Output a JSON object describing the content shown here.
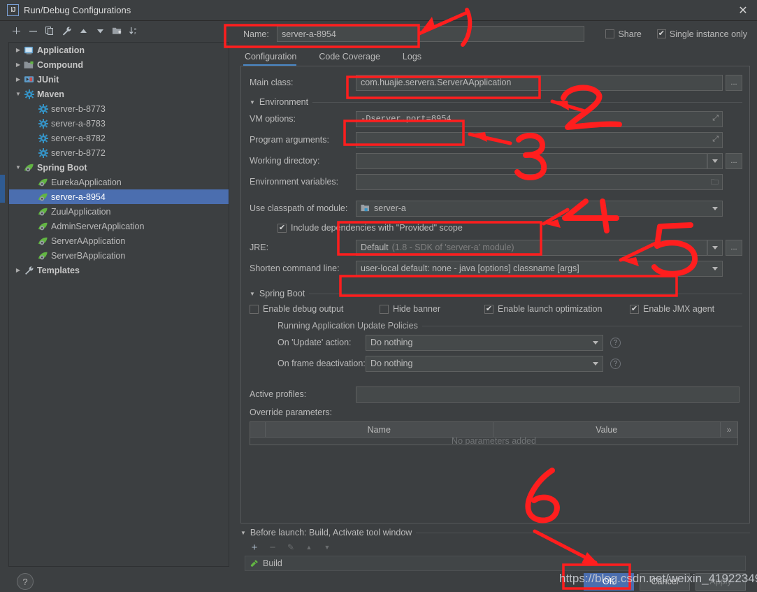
{
  "window": {
    "title": "Run/Debug Configurations",
    "app_icon": "IJ",
    "close_icon": "close-icon"
  },
  "toolbar": {
    "buttons": [
      {
        "name": "add-configuration",
        "icon": "plus-icon",
        "label": "+"
      },
      {
        "name": "remove-configuration",
        "icon": "minus-icon",
        "label": "−"
      },
      {
        "name": "copy-configuration",
        "icon": "copy-icon",
        "label": "copy"
      },
      {
        "name": "edit-templates",
        "icon": "wrench-icon",
        "label": "wrench"
      },
      {
        "name": "move-up",
        "icon": "arrow-up-icon",
        "label": "up"
      },
      {
        "name": "move-down",
        "icon": "arrow-down-icon",
        "label": "down"
      },
      {
        "name": "new-folder",
        "icon": "folder-add-icon",
        "label": "folder"
      },
      {
        "name": "sort-alphabetically",
        "icon": "sort-az-icon",
        "label": "sort"
      }
    ]
  },
  "tree": {
    "nodes": [
      {
        "label": "Application",
        "icon": "application-icon",
        "group": true,
        "expanded": false,
        "indent": 0,
        "selected": false
      },
      {
        "label": "Compound",
        "icon": "compound-icon",
        "group": true,
        "expanded": false,
        "indent": 0,
        "selected": false
      },
      {
        "label": "JUnit",
        "icon": "junit-icon",
        "group": true,
        "expanded": false,
        "indent": 0,
        "selected": false
      },
      {
        "label": "Maven",
        "icon": "maven-icon",
        "group": true,
        "expanded": true,
        "indent": 0,
        "selected": false
      },
      {
        "label": "server-b-8773",
        "icon": "maven-icon",
        "group": false,
        "indent": 1,
        "selected": false
      },
      {
        "label": "server-a-8783",
        "icon": "maven-icon",
        "group": false,
        "indent": 1,
        "selected": false
      },
      {
        "label": "server-a-8782",
        "icon": "maven-icon",
        "group": false,
        "indent": 1,
        "selected": false
      },
      {
        "label": "server-b-8772",
        "icon": "maven-icon",
        "group": false,
        "indent": 1,
        "selected": false
      },
      {
        "label": "Spring Boot",
        "icon": "spring-boot-icon",
        "group": true,
        "expanded": true,
        "indent": 0,
        "selected": false
      },
      {
        "label": "EurekaApplication",
        "icon": "spring-boot-icon",
        "group": false,
        "indent": 1,
        "selected": false
      },
      {
        "label": "server-a-8954",
        "icon": "spring-boot-icon",
        "group": false,
        "indent": 1,
        "selected": true
      },
      {
        "label": "ZuulApplication",
        "icon": "spring-boot-icon",
        "group": false,
        "indent": 1,
        "selected": false
      },
      {
        "label": "AdminServerApplication",
        "icon": "spring-boot-icon",
        "group": false,
        "indent": 1,
        "selected": false
      },
      {
        "label": "ServerAApplication",
        "icon": "spring-boot-icon",
        "group": false,
        "indent": 1,
        "selected": false
      },
      {
        "label": "ServerBApplication",
        "icon": "spring-boot-icon",
        "group": false,
        "indent": 1,
        "selected": false
      },
      {
        "label": "Templates",
        "icon": "templates-icon",
        "group": true,
        "expanded": false,
        "indent": 0,
        "selected": false
      }
    ]
  },
  "header": {
    "name_label": "Name:",
    "name_value": "server-a-8954",
    "share_label": "Share",
    "share_checked": false,
    "single_instance_label": "Single instance only",
    "single_instance_checked": true
  },
  "tabs": [
    {
      "label": "Configuration",
      "active": true
    },
    {
      "label": "Code Coverage",
      "active": false
    },
    {
      "label": "Logs",
      "active": false
    }
  ],
  "form": {
    "main_class": {
      "label": "Main class:",
      "value": "com.huajie.servera.ServerAApplication",
      "browse": "..."
    },
    "environment_group": "Environment",
    "vm_options": {
      "label": "VM options:",
      "value": "-Dserver.port=8954"
    },
    "program_arguments": {
      "label": "Program arguments:",
      "value": ""
    },
    "working_directory": {
      "label": "Working directory:",
      "value": "",
      "browse": "..."
    },
    "environment_variables": {
      "label": "Environment variables:",
      "value": "",
      "icon": "folder-icon"
    },
    "use_classpath": {
      "label": "Use classpath of module:",
      "value": "server-a",
      "icon": "module-icon"
    },
    "include_provided": {
      "label": "Include dependencies with \"Provided\" scope",
      "checked": true
    },
    "jre": {
      "label": "JRE:",
      "value": "Default",
      "hint": "(1.8 - SDK of 'server-a' module)",
      "browse": "..."
    },
    "shorten_command_line": {
      "label": "Shorten command line:",
      "value": "user-local default: none - java [options] classname [args]"
    }
  },
  "spring_boot": {
    "group_label": "Spring Boot",
    "checkboxes": [
      {
        "label": "Enable debug output",
        "checked": false
      },
      {
        "label": "Hide banner",
        "checked": false
      },
      {
        "label": "Enable launch optimization",
        "checked": true
      },
      {
        "label": "Enable JMX agent",
        "checked": true
      }
    ],
    "update_policies_label": "Running Application Update Policies",
    "on_update_action": {
      "label": "On 'Update' action:",
      "value": "Do nothing",
      "help": "?"
    },
    "on_frame_deactivation": {
      "label": "On frame deactivation:",
      "value": "Do nothing",
      "help": "?"
    },
    "active_profiles": {
      "label": "Active profiles:",
      "value": ""
    },
    "override_parameters": {
      "label": "Override parameters:",
      "columns": [
        "",
        "Name",
        "Value",
        "»"
      ],
      "empty_text": "No parameters added",
      "rows": []
    }
  },
  "before_launch": {
    "title": "Before launch: Build, Activate tool window",
    "toolbar": [
      {
        "name": "add-task",
        "icon": "plus-icon",
        "label": "+",
        "enabled": true
      },
      {
        "name": "remove-task",
        "icon": "minus-icon",
        "label": "−",
        "enabled": false
      },
      {
        "name": "edit-task",
        "icon": "pencil-icon",
        "label": "✎",
        "enabled": false
      },
      {
        "name": "move-task-up",
        "icon": "arrow-up-icon",
        "label": "▲",
        "enabled": false
      },
      {
        "name": "move-task-down",
        "icon": "arrow-down-icon",
        "label": "▼",
        "enabled": false
      }
    ],
    "items": [
      {
        "label": "Build",
        "icon": "build-hammer-icon"
      }
    ]
  },
  "footer": {
    "help_label": "?",
    "ok_label": "OK",
    "cancel_label": "Cancel",
    "apply_label": "Apply"
  },
  "annotations": {
    "watermark": "https://blog.csdn.net/weixin_41922349",
    "markers": [
      "1",
      "2",
      "3",
      "4",
      "5",
      "6"
    ],
    "color": "#ff1e1e"
  }
}
